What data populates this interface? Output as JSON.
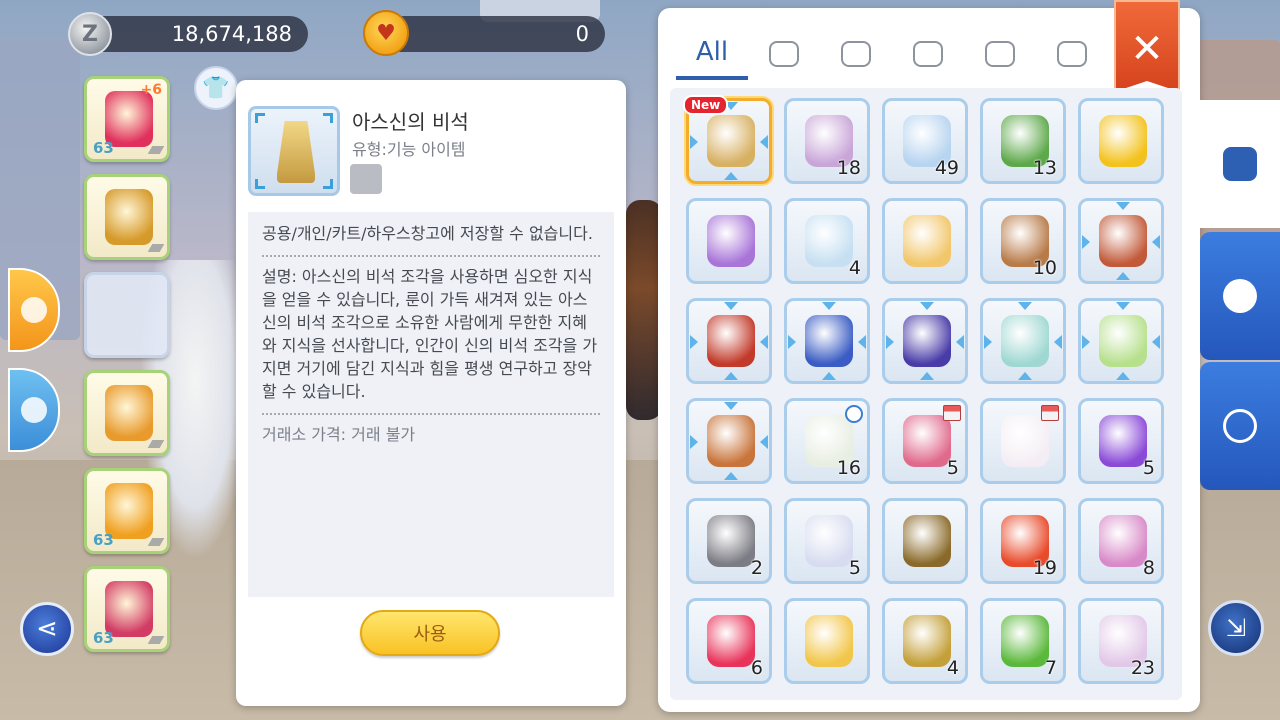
{
  "currency": {
    "zeny_icon": "Z",
    "zeny": "18,674,188",
    "pet_points": "0"
  },
  "equipment": [
    {
      "name": "wings",
      "level": "63",
      "plus": "+6",
      "color": "#e0305c"
    },
    {
      "name": "armor",
      "level": "",
      "plus": "",
      "color": "#d69a2a"
    },
    {
      "name": "cape-empty",
      "level": "",
      "plus": "",
      "color": ""
    },
    {
      "name": "boots",
      "level": "",
      "plus": "",
      "color": "#e89a2c"
    },
    {
      "name": "ring-gold",
      "level": "63",
      "plus": "",
      "color": "#f0a020"
    },
    {
      "name": "ring-red",
      "level": "63",
      "plus": "",
      "color": "#d23c64"
    }
  ],
  "detail": {
    "item_name": "아스신의 비석",
    "item_type": "유형:기능 아이템",
    "storage": "공용/개인/카트/하우스창고에 저장할 수 없습니다.",
    "description": "설명: 아스신의 비석 조각을 사용하면 심오한 지식을 얻을 수 있습니다, 룬이 가득 새겨져 있는 아스신의 비석 조각으로 소유한 사람에게 무한한 지혜와 지식을 선사합니다, 인간이 신의 비석 조각을 가지면 거기에 담긴 지식과 힘을 평생 연구하고 장악할 수 있습니다.",
    "price": "거래소 가격: 거래 불가",
    "use_label": "사용"
  },
  "inventory": {
    "tabs": [
      {
        "label": "All",
        "icon": "all"
      },
      {
        "label": "",
        "icon": "heart-icon"
      },
      {
        "label": "",
        "icon": "shirt-icon"
      },
      {
        "label": "",
        "icon": "potion-icon"
      },
      {
        "label": "",
        "icon": "diamond-icon"
      },
      {
        "label": "",
        "icon": "card-icon"
      }
    ],
    "close": "✕",
    "new_badge": "New",
    "items": [
      {
        "name": "asgod-stele",
        "qty": "",
        "color": "#d7b062",
        "new": true,
        "marks": true
      },
      {
        "name": "butterfly-wing",
        "qty": "18",
        "color": "#c9a6d8"
      },
      {
        "name": "fly-wing",
        "qty": "49",
        "color": "#b7d4f0"
      },
      {
        "name": "leaf",
        "qty": "13",
        "color": "#5da84a"
      },
      {
        "name": "mystery-coin",
        "qty": "",
        "color": "#f3c21c"
      },
      {
        "name": "purple-orbs",
        "qty": "",
        "color": "#a874d8"
      },
      {
        "name": "holo-box",
        "qty": "4",
        "color": "#c6e0f2"
      },
      {
        "name": "gift-box",
        "qty": "",
        "color": "#f2c66a"
      },
      {
        "name": "coin-bag",
        "qty": "10",
        "color": "#b87a48"
      },
      {
        "name": "pet-bag",
        "qty": "",
        "color": "#c25a3a",
        "marks": true
      },
      {
        "name": "red-book",
        "qty": "",
        "color": "#c23a2a",
        "marks": true
      },
      {
        "name": "blue-case",
        "qty": "",
        "color": "#3a5cc4",
        "marks": true
      },
      {
        "name": "magic-drum",
        "qty": "",
        "color": "#4a3ca8",
        "marks": true
      },
      {
        "name": "egg-box",
        "qty": "",
        "color": "#9fd8d2",
        "marks": true
      },
      {
        "name": "lucky-box",
        "qty": "",
        "color": "#b6e08c",
        "marks": true
      },
      {
        "name": "backpack",
        "qty": "",
        "color": "#c8743a",
        "marks": true
      },
      {
        "name": "flower-wreath",
        "qty": "16",
        "color": "#e8eee2",
        "clock": true
      },
      {
        "name": "pink-folder",
        "qty": "5",
        "color": "#e06a8c",
        "shop": true
      },
      {
        "name": "white-cube",
        "qty": "",
        "color": "#f4eef4",
        "shop": true
      },
      {
        "name": "potion-flask",
        "qty": "5",
        "color": "#8a4ad8"
      },
      {
        "name": "iron-pot",
        "qty": "2",
        "color": "#7c7c84"
      },
      {
        "name": "hex-stone",
        "qty": "5",
        "color": "#d8dcf0"
      },
      {
        "name": "fruit-husk",
        "qty": "",
        "color": "#8a6a2a"
      },
      {
        "name": "apple-drink",
        "qty": "19",
        "color": "#e84a2a"
      },
      {
        "name": "pink-bud",
        "qty": "8",
        "color": "#d88ac8"
      },
      {
        "name": "candy",
        "qty": "6",
        "color": "#e8345a"
      },
      {
        "name": "golden-pear",
        "qty": "",
        "color": "#f2c64a"
      },
      {
        "name": "honey-jar",
        "qty": "4",
        "color": "#c4a03a"
      },
      {
        "name": "green-bottle",
        "qty": "7",
        "color": "#5ab83a"
      },
      {
        "name": "glass-vase",
        "qty": "23",
        "color": "#e2c8e8"
      }
    ]
  },
  "colors": {
    "accent": "#2f5faa",
    "close": "#e04e25",
    "use_button": "#f9c224"
  }
}
